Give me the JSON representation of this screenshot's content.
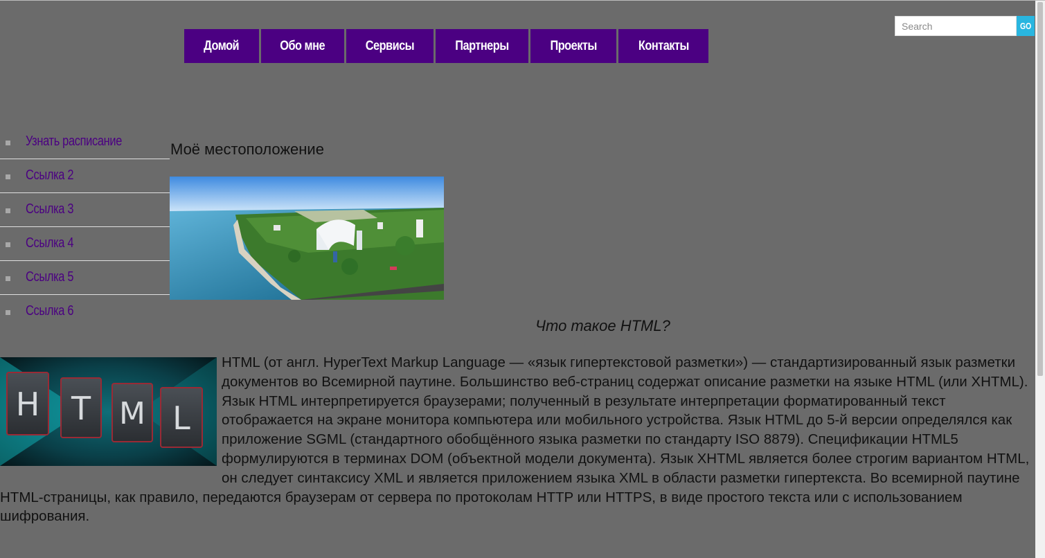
{
  "nav": {
    "items": [
      {
        "label": "Домой"
      },
      {
        "label": "Обо мне"
      },
      {
        "label": "Сервисы"
      },
      {
        "label": "Партнеры"
      },
      {
        "label": "Проекты"
      },
      {
        "label": "Контакты"
      }
    ]
  },
  "search": {
    "placeholder": "Search",
    "button_label": "GO"
  },
  "sidebar": {
    "items": [
      {
        "label": "Узнать расписание"
      },
      {
        "label": "Ссылка 2"
      },
      {
        "label": "Ссылка 3"
      },
      {
        "label": "Ссылка 4"
      },
      {
        "label": "Ссылка 5"
      },
      {
        "label": "Ссылка 6"
      }
    ]
  },
  "main": {
    "location_heading": "Моё местоположение",
    "section_title": "Что такое HTML?",
    "logo_letters": [
      "H",
      "T",
      "M",
      "L"
    ],
    "body_text": "HTML (от англ. HyperText Markup Language — «язык гипертекстовой разметки») — стандартизированный язык разметки документов во Всемирной паутине. Большинство веб-страниц содержат описание разметки на языке HTML (или XHTML). Язык HTML интерпретируется браузерами; полученный в результате интерпретации форматированный текст отображается на экране монитора компьютера или мобильного устройства. Язык HTML до 5-й версии определялся как приложение SGML (стандартного обобщённого языка разметки по стандарту ISO 8879). Спецификации HTML5 формулируются в терминах DOM (объектной модели документа). Язык XHTML является более строгим вариантом HTML, он следует синтаксису XML и является приложением языка XML в области разметки гипертекста. Во всемирной паутине HTML-страницы, как правило, передаются браузерам от сервера по протоколам HTTP или HTTPS, в виде простого текста или с использованием шифрования."
  },
  "colors": {
    "background": "#6b6b6b",
    "nav_bg": "#4b0082",
    "link": "#4b0082",
    "search_button": "#29b6e0"
  }
}
